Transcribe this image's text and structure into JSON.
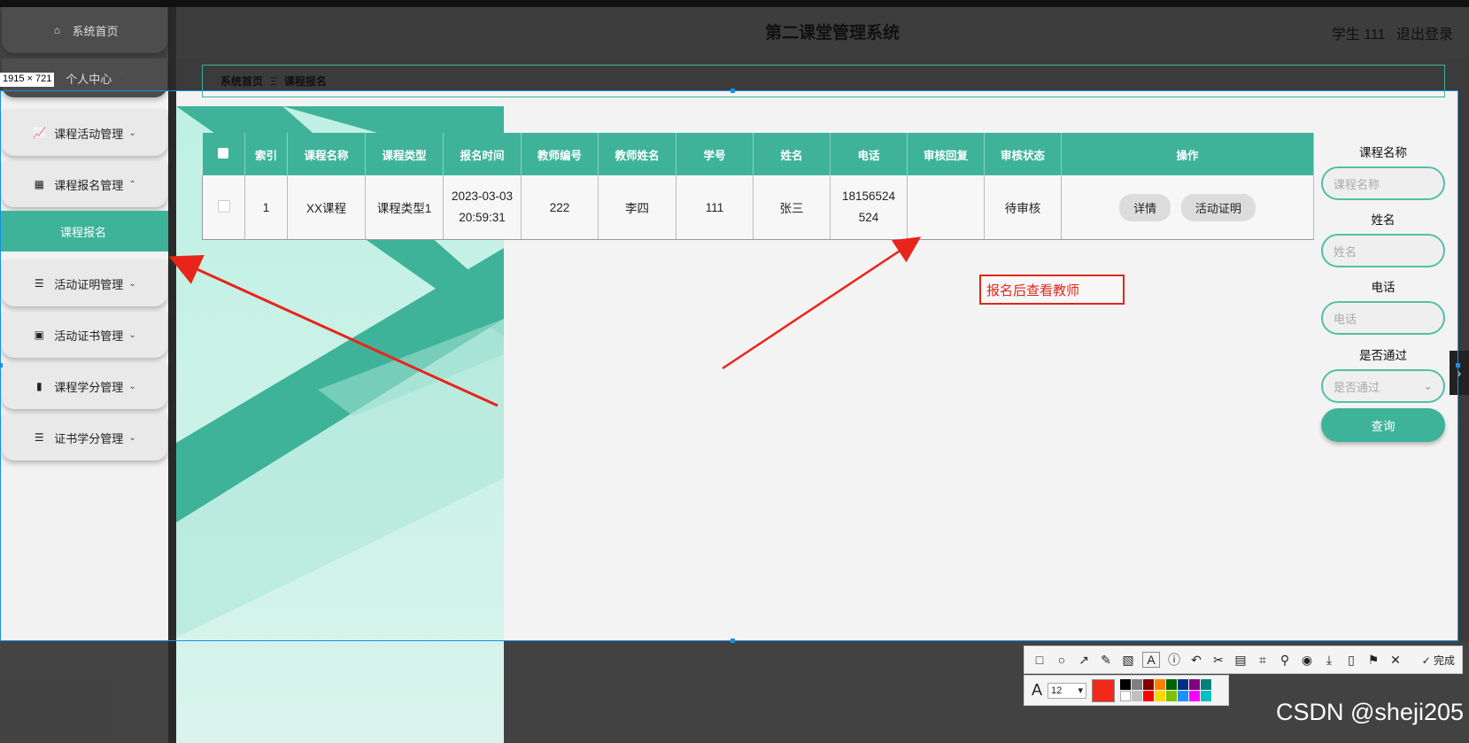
{
  "app": {
    "title": "第二课堂管理系统",
    "user_label": "学生 111",
    "logout_label": "退出登录"
  },
  "size_badge": "1915 × 721",
  "sidebar": {
    "home": "系统首页",
    "profile": "个人中心",
    "items": [
      {
        "label": "课程活动管理",
        "icon": "line-chart-icon"
      },
      {
        "label": "课程报名管理",
        "icon": "grid-icon"
      },
      {
        "label": "活动证明管理",
        "icon": "list-icon"
      },
      {
        "label": "活动证书管理",
        "icon": "tiles-icon"
      },
      {
        "label": "课程学分管理",
        "icon": "bar-chart-icon"
      },
      {
        "label": "证书学分管理",
        "icon": "list-icon"
      }
    ],
    "active_sub": "课程报名"
  },
  "breadcrumb": {
    "home": "系统首页",
    "separator": "Ξ",
    "current": "课程报名"
  },
  "table": {
    "columns": [
      "索引",
      "课程名称",
      "课程类型",
      "报名时间",
      "教师编号",
      "教师姓名",
      "学号",
      "姓名",
      "电话",
      "审核回复",
      "审核状态",
      "操作"
    ],
    "rows": [
      {
        "index": "1",
        "course": "XX课程",
        "type": "课程类型1",
        "time": "2023-03-03 20:59:31",
        "teacher_no": "222",
        "teacher_name": "李四",
        "student_no": "111",
        "name": "张三",
        "phone": "18156524524",
        "reply": "",
        "status": "待审核",
        "btn_detail": "详情",
        "btn_proof": "活动证明"
      }
    ]
  },
  "annotation": "报名后查看教师",
  "search": {
    "course_label": "课程名称",
    "course_placeholder": "课程名称",
    "name_label": "姓名",
    "name_placeholder": "姓名",
    "phone_label": "电话",
    "phone_placeholder": "电话",
    "pass_label": "是否通过",
    "pass_placeholder": "是否通过",
    "query_button": "查询"
  },
  "toolbar": {
    "done_label": "完成",
    "font_size": "12"
  },
  "colors": {
    "accent": "#3eb39a",
    "annotation_red": "#e0261a"
  },
  "watermark": "CSDN @sheji205"
}
